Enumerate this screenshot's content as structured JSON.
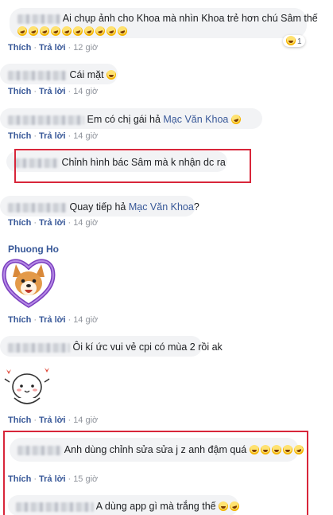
{
  "common": {
    "like": "Thích",
    "reply": "Trả lời",
    "dot": "·"
  },
  "comments": [
    {
      "text": "Ai chụp ảnh cho Khoa mà nhìn Khoa trẻ hơn chú Sâm thế",
      "time": "12 giờ",
      "reaction_count": "1"
    },
    {
      "text": "Cái mặt",
      "time": "14 giờ"
    },
    {
      "text": "Em có chị gái hả ",
      "mention": "Mạc Văn Khoa",
      "time": "14 giờ"
    },
    {
      "text": "Chỉnh hình bác Sâm mà k nhận dc ra"
    },
    {
      "text": "Quay tiếp hả ",
      "mention": "Mạc Văn Khoa",
      "suffix": "?",
      "time": "14 giờ"
    },
    {
      "author": "Phuong Ho",
      "time": "14 giờ"
    },
    {
      "text": "Ôi kí ức vui vẻ cpi có mùa 2 rồi ak",
      "time": "14 giờ"
    },
    {
      "time": "14 giờ"
    },
    {
      "text": "Anh dùng chỉnh sửa sửa j z anh đậm quá",
      "time": "15 giờ"
    },
    {
      "text": "A dùng app gì mà trắng thế"
    }
  ],
  "colors": {
    "highlight": "#d8263a",
    "link": "#385898",
    "bubble": "#f2f3f5"
  }
}
